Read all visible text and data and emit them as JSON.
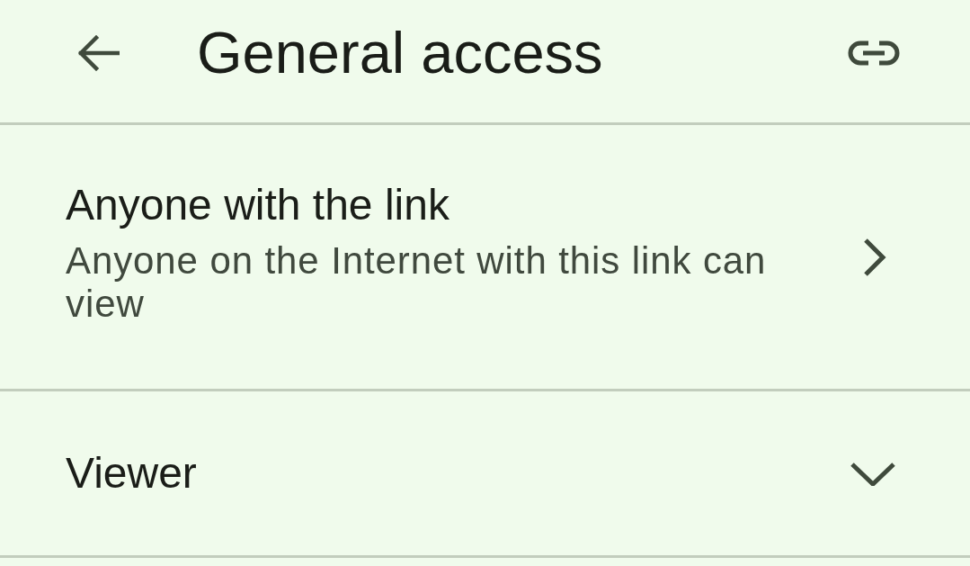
{
  "header": {
    "title": "General access"
  },
  "access_option": {
    "title": "Anyone with the link",
    "description": "Anyone on the Internet with this link can view"
  },
  "role": {
    "label": "Viewer"
  }
}
